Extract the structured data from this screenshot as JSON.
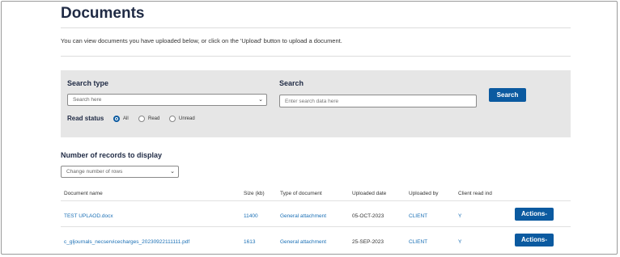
{
  "page": {
    "title": "Documents",
    "intro": "You can view documents you have uploaded below, or click on the 'Upload' button to upload a document."
  },
  "search_panel": {
    "search_type_label": "Search type",
    "search_type_value": "Search here",
    "search_label": "Search",
    "search_placeholder": "Enter search data here",
    "search_button": "Search",
    "read_status_label": "Read status",
    "read_options": [
      {
        "label": "All",
        "selected": true
      },
      {
        "label": "Read",
        "selected": false
      },
      {
        "label": "Unread",
        "selected": false
      }
    ]
  },
  "records": {
    "label": "Number of records to display",
    "select_value": "Change number of rows"
  },
  "table": {
    "columns": [
      "Document name",
      "Size (kb)",
      "Type of document",
      "Uploaded date",
      "Uploaded by",
      "Client read ind"
    ],
    "rows": [
      {
        "name": "TEST UPLAOD.docx",
        "size": "11400",
        "type": "General attachment",
        "date": "05-OCT-2023",
        "by": "CLIENT",
        "read": "Y",
        "action": "Actions-"
      },
      {
        "name": "c_gljournals_necservicecharges_20230922111111.pdf",
        "size": "1613",
        "type": "General attachment",
        "date": "25-SEP-2023",
        "by": "CLIENT",
        "read": "Y",
        "action": "Actions-"
      }
    ]
  },
  "colors": {
    "accent": "#0b5aa0",
    "link": "#1a6fb5",
    "panel": "#e6e6e6",
    "title": "#1f2a44"
  },
  "icons": [
    "chevron-down-icon",
    "chevron-down-icon"
  ]
}
